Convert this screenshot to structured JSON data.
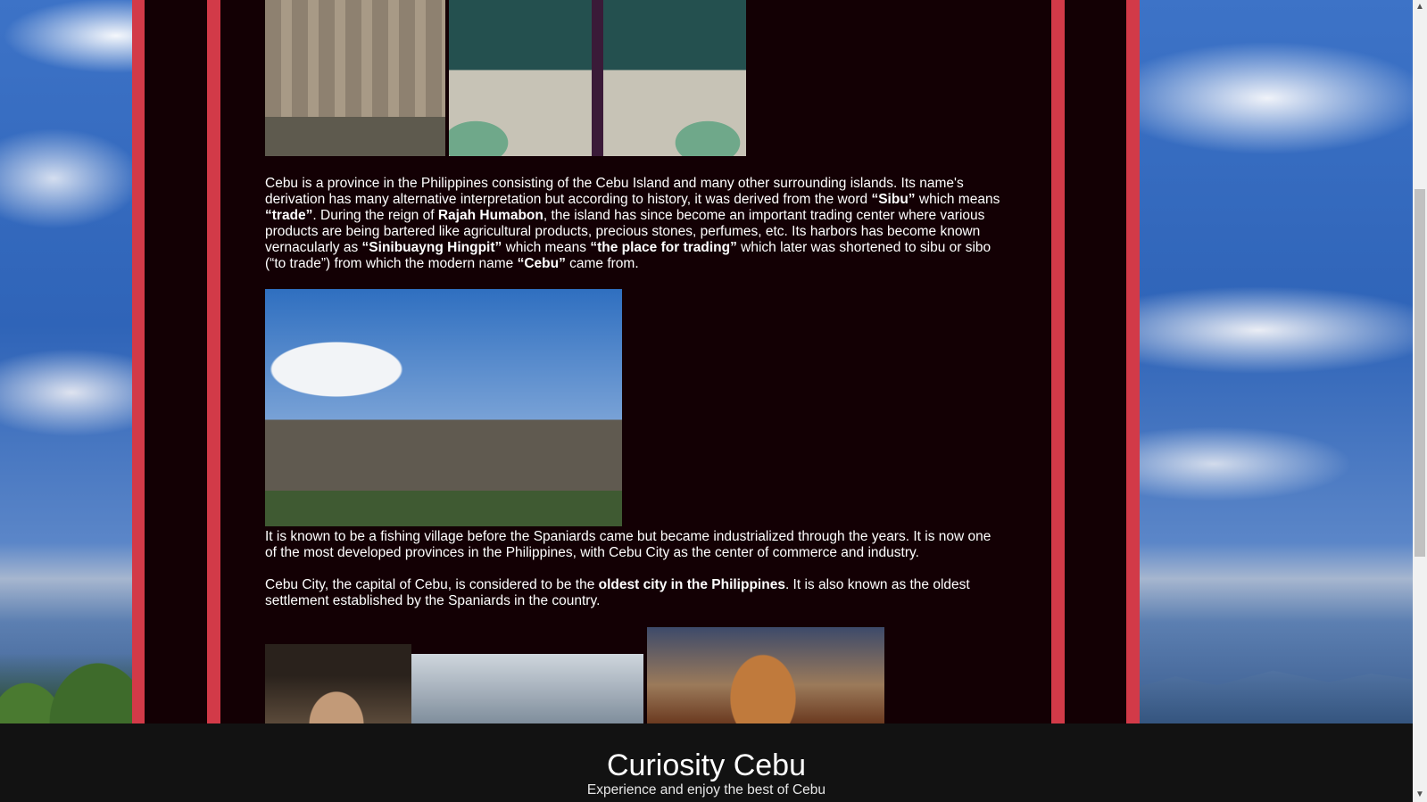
{
  "paragraphs": {
    "p1": [
      {
        "t": "Cebu is a province in the Philippines consisting of the Cebu Island and many other surrounding islands. Its name's derivation has many alternative interpretation but according to history, it was derived from the word ",
        "b": false
      },
      {
        "t": "“Sibu”",
        "b": true
      },
      {
        "t": " which means ",
        "b": false
      },
      {
        "t": "“trade”",
        "b": true
      },
      {
        "t": ". During the reign of ",
        "b": false
      },
      {
        "t": "Rajah Humabon",
        "b": true
      },
      {
        "t": ", the island has since become an important trading center where various products are being bartered like agricultural products, precious stones, perfumes, etc. Its harbors has become known vernacularly as ",
        "b": false
      },
      {
        "t": "“Sinibuayng Hingpit”",
        "b": true
      },
      {
        "t": " which means ",
        "b": false
      },
      {
        "t": "“the place for trading”",
        "b": true
      },
      {
        "t": " which later was shortened to sibu or sibo (“to trade”) from which the modern name ",
        "b": false
      },
      {
        "t": "“Cebu”",
        "b": true
      },
      {
        "t": " came from.",
        "b": false
      }
    ],
    "p2": [
      {
        "t": "It is known to be a fishing village before the Spaniards came but became industrialized through the years. It is now one of the most developed provinces in the Philippines, with Cebu City as the center of commerce and industry.",
        "b": false
      }
    ],
    "p3": [
      {
        "t": "Cebu City, the capital of Cebu, is considered to be the ",
        "b": false
      },
      {
        "t": "oldest city in the Philippines",
        "b": true
      },
      {
        "t": ". It is also known as the oldest settlement established by the Spaniards in the country.",
        "b": false
      }
    ]
  },
  "footer": {
    "title": "Curiosity Cebu",
    "tagline": "Experience and enjoy the best of Cebu"
  },
  "colors": {
    "stripe_red": "#d23a48",
    "panel_dark": "#130004",
    "footer_bg": "#121212"
  },
  "icons": {
    "scroll_up": "scroll-up-arrow-icon",
    "scroll_down": "scroll-down-arrow-icon"
  }
}
